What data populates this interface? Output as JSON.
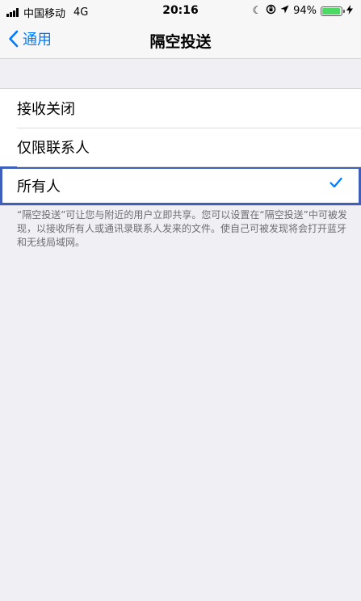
{
  "status_bar": {
    "carrier": "中国移动",
    "network": "4G",
    "time": "20:16",
    "battery_percent": "94%",
    "battery_level": 0.94,
    "icons": [
      "moon-icon",
      "orientation-lock-icon",
      "location-icon",
      "charging-icon"
    ]
  },
  "nav": {
    "back_label": "通用",
    "title": "隔空投送"
  },
  "options": [
    {
      "label": "接收关闭",
      "selected": false
    },
    {
      "label": "仅限联系人",
      "selected": false
    },
    {
      "label": "所有人",
      "selected": true
    }
  ],
  "footer_text": "“隔空投送”可让您与附近的用户立即共享。您可以设置在“隔空投送”中可被发现，以接收所有人或通讯录联系人发来的文件。使自己可被发现将会打开蓝牙和无线局域网。",
  "colors": {
    "accent": "#007aff",
    "selection_outline": "#3f5fbd",
    "battery": "#4cd964",
    "background": "#efeff4"
  }
}
